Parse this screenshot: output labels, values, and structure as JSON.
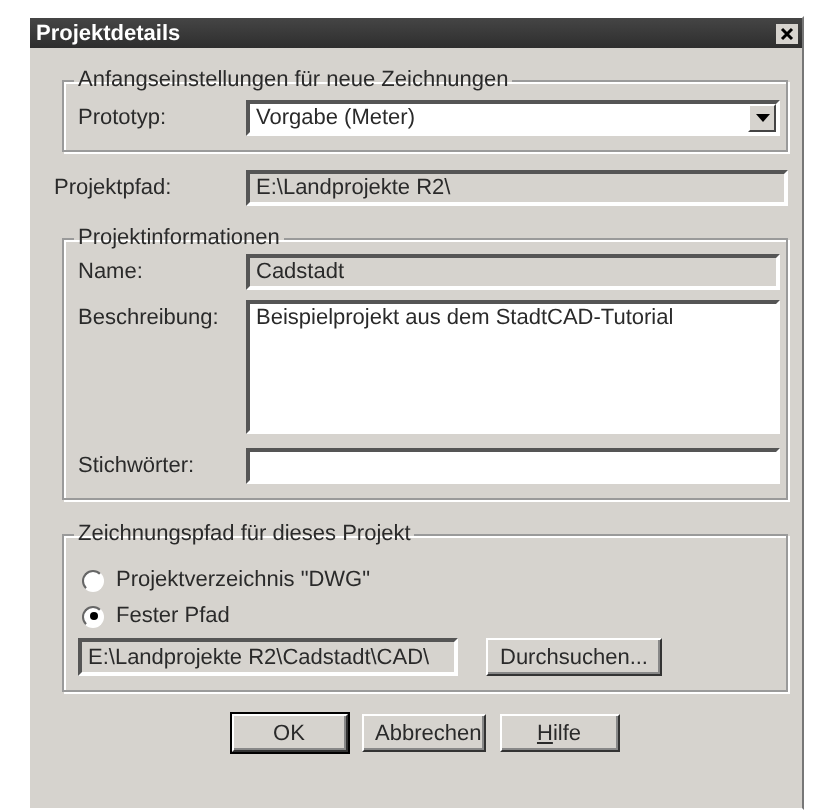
{
  "window": {
    "title": "Projektdetails"
  },
  "initial_settings": {
    "legend": "Anfangseinstellungen für neue Zeichnungen",
    "prototype": {
      "label": "Prototyp:",
      "value": "Vorgabe (Meter)"
    }
  },
  "project_path": {
    "label": "Projektpfad:",
    "value": "E:\\Landprojekte R2\\",
    "disabled": true
  },
  "project_info": {
    "legend": "Projektinformationen",
    "name": {
      "label": "Name:",
      "value": "Cadstadt",
      "disabled": true
    },
    "description": {
      "label": "Beschreibung:",
      "value": "Beispielprojekt aus dem StadtCAD-Tutorial",
      "disabled": false
    },
    "keywords": {
      "label": "Stichwörter:",
      "disabled": false
    }
  },
  "drawing_path": {
    "legend": "Zeichnungspfad für dieses Projekt",
    "options": [
      {
        "label": "Projektverzeichnis \"DWG\"",
        "selected": false
      },
      {
        "label": "Fester Pfad",
        "selected": true
      }
    ],
    "path": {
      "value": "E:\\Landprojekte R2\\Cadstadt\\CAD\\",
      "disabled": true
    },
    "browse_button": "Durchsuchen..."
  },
  "buttons": [
    {
      "label": "OK",
      "default": true
    },
    {
      "label": "Abbrechen",
      "default": false
    },
    {
      "label": "Hilfe",
      "default": false
    }
  ]
}
